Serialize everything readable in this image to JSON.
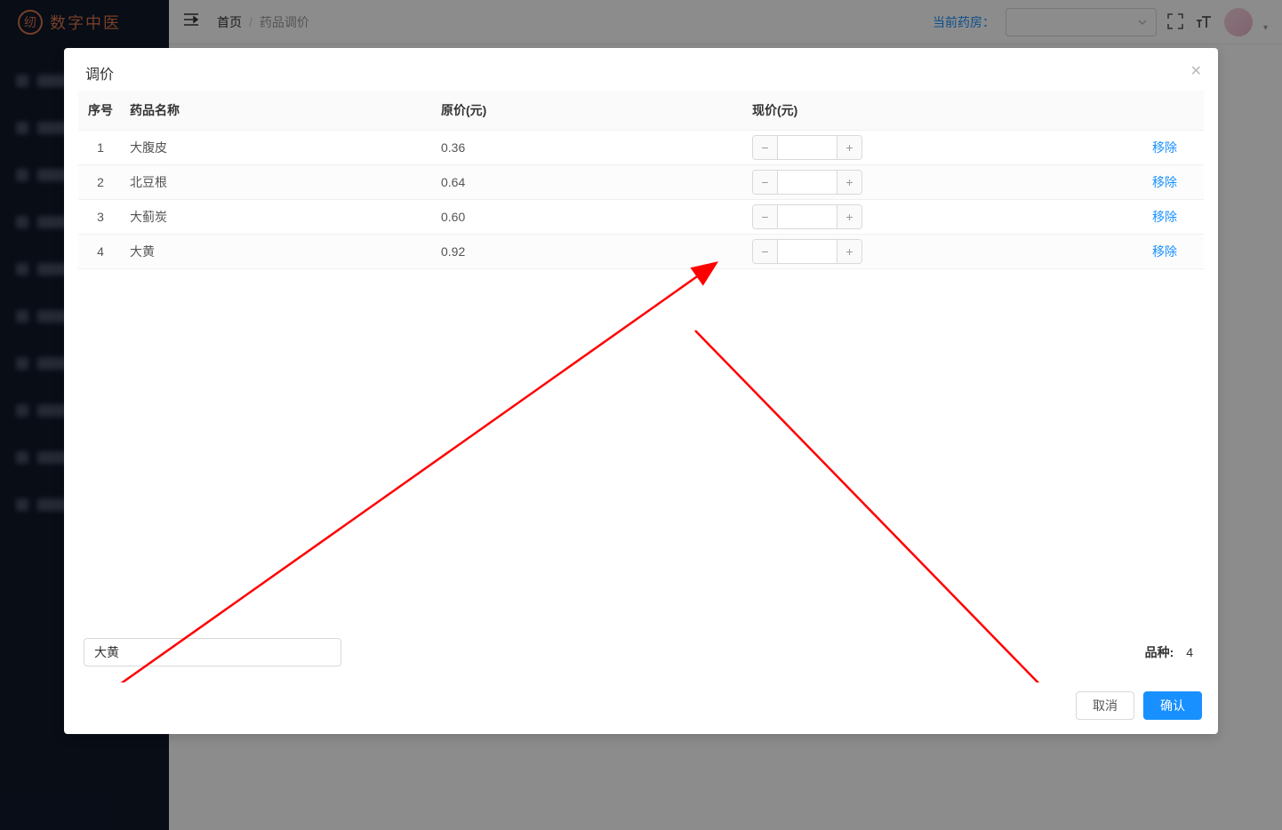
{
  "app": {
    "logo_text": "数字中医"
  },
  "header": {
    "breadcrumb_home": "首页",
    "breadcrumb_current": "药品调价",
    "pharmacy_label": "当前药房："
  },
  "modal": {
    "title": "调价",
    "columns": {
      "seq": "序号",
      "name": "药品名称",
      "orig_price": "原价(元)",
      "curr_price": "现价(元)"
    },
    "rows": [
      {
        "seq": "1",
        "name": "大腹皮",
        "orig": "0.36",
        "curr": ""
      },
      {
        "seq": "2",
        "name": "北豆根",
        "orig": "0.64",
        "curr": ""
      },
      {
        "seq": "3",
        "name": "大蓟炭",
        "orig": "0.60",
        "curr": ""
      },
      {
        "seq": "4",
        "name": "大黄",
        "orig": "0.92",
        "curr": ""
      }
    ],
    "remove_label": "移除",
    "search_value": "大黄",
    "variety_label": "品种:",
    "variety_count": "4",
    "btn_cancel": "取消",
    "btn_confirm": "确认"
  }
}
